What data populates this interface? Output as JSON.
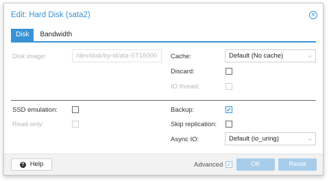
{
  "dialog": {
    "title": "Edit: Hard Disk (sata2)",
    "tabs": [
      {
        "label": "Disk",
        "active": true
      },
      {
        "label": "Bandwidth",
        "active": false
      }
    ]
  },
  "left": {
    "disk_image_label": "Disk image:",
    "disk_image_value": "/dev/disk/by-id/ata-ST16000",
    "ssd_emulation_label": "SSD emulation:",
    "read_only_label": "Read-only:"
  },
  "right": {
    "cache_label": "Cache:",
    "cache_value": "Default (No cache)",
    "discard_label": "Discard:",
    "io_thread_label": "IO thread:",
    "backup_label": "Backup:",
    "skip_replication_label": "Skip replication:",
    "async_io_label": "Async IO:",
    "async_io_value": "Default (io_uring)"
  },
  "footer": {
    "help_label": "Help",
    "advanced_label": "Advanced",
    "ok_label": "OK",
    "reset_label": "Reset"
  },
  "icons": {
    "close": "close-circle-icon",
    "help": "question-circle-icon",
    "dropdown": "chevron-down-icon",
    "check": "checkmark-icon"
  },
  "colors": {
    "accent": "#3892d4",
    "disabled_button": "#a8cdea"
  },
  "state": {
    "backup_checked": true,
    "advanced_checked": true,
    "discard_checked": false,
    "ssd_emulation_checked": false,
    "skip_replication_checked": false
  }
}
